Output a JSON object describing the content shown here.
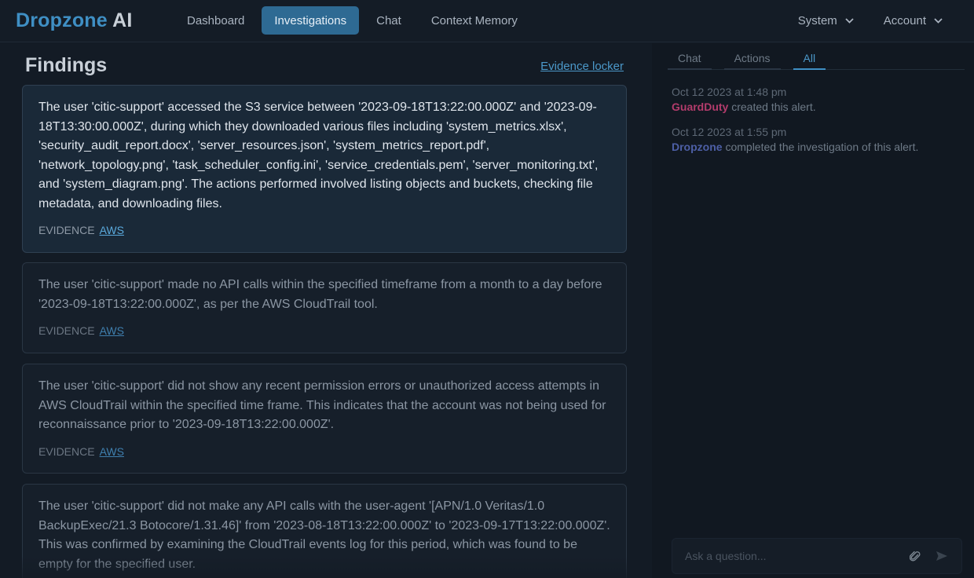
{
  "brand": {
    "part1": "Dropzone",
    "part2": "AI"
  },
  "nav": {
    "items": [
      {
        "label": "Dashboard"
      },
      {
        "label": "Investigations",
        "active": true
      },
      {
        "label": "Chat"
      },
      {
        "label": "Context Memory"
      }
    ],
    "right": [
      {
        "label": "System"
      },
      {
        "label": "Account"
      }
    ]
  },
  "findings": {
    "title": "Findings",
    "evidence_locker": "Evidence locker",
    "evidence_label": "EVIDENCE",
    "cards": [
      {
        "text": "The user 'citic-support' accessed the S3 service between '2023-09-18T13:22:00.000Z' and '2023-09-18T13:30:00.000Z', during which they downloaded various files including 'system_metrics.xlsx', 'security_audit_report.docx', 'server_resources.json', 'system_metrics_report.pdf', 'network_topology.png', 'task_scheduler_config.ini', 'service_credentials.pem', 'server_monitoring.txt', and 'system_diagram.png'. The actions performed involved listing objects and buckets, checking file metadata, and downloading files.",
        "evidence_link": "AWS"
      },
      {
        "text": "The user 'citic-support' made no API calls within the specified timeframe from a month to a day before '2023-09-18T13:22:00.000Z', as per the AWS CloudTrail tool.",
        "evidence_link": "AWS"
      },
      {
        "text": "The user 'citic-support' did not show any recent permission errors or unauthorized access attempts in AWS CloudTrail within the specified time frame. This indicates that the account was not being used for reconnaissance prior to '2023-09-18T13:22:00.000Z'.",
        "evidence_link": "AWS"
      },
      {
        "text": "The user 'citic-support' did not make any API calls with the user-agent '[APN/1.0 Veritas/1.0 BackupExec/21.3 Botocore/1.31.46]' from '2023-08-18T13:22:00.000Z' to '2023-09-17T13:22:00.000Z'. This was confirmed by examining the CloudTrail events log for this period, which was found to be empty for the specified user."
      }
    ]
  },
  "sidebar": {
    "tabs": [
      {
        "label": "Chat"
      },
      {
        "label": "Actions"
      },
      {
        "label": "All",
        "active": true
      }
    ],
    "events": [
      {
        "date": "Oct 12 2023 at 1:48 pm",
        "actor": "GuardDuty",
        "action": "created this alert."
      },
      {
        "date": "Oct 12 2023 at 1:55 pm",
        "actor": "Dropzone",
        "action": "completed the investigation of this alert."
      }
    ],
    "ask": {
      "placeholder": "Ask a question..."
    }
  },
  "colors": {
    "accent": "#3f8fc4",
    "guardduty": "#b33c6c",
    "dropzone": "#4d5fa6"
  }
}
